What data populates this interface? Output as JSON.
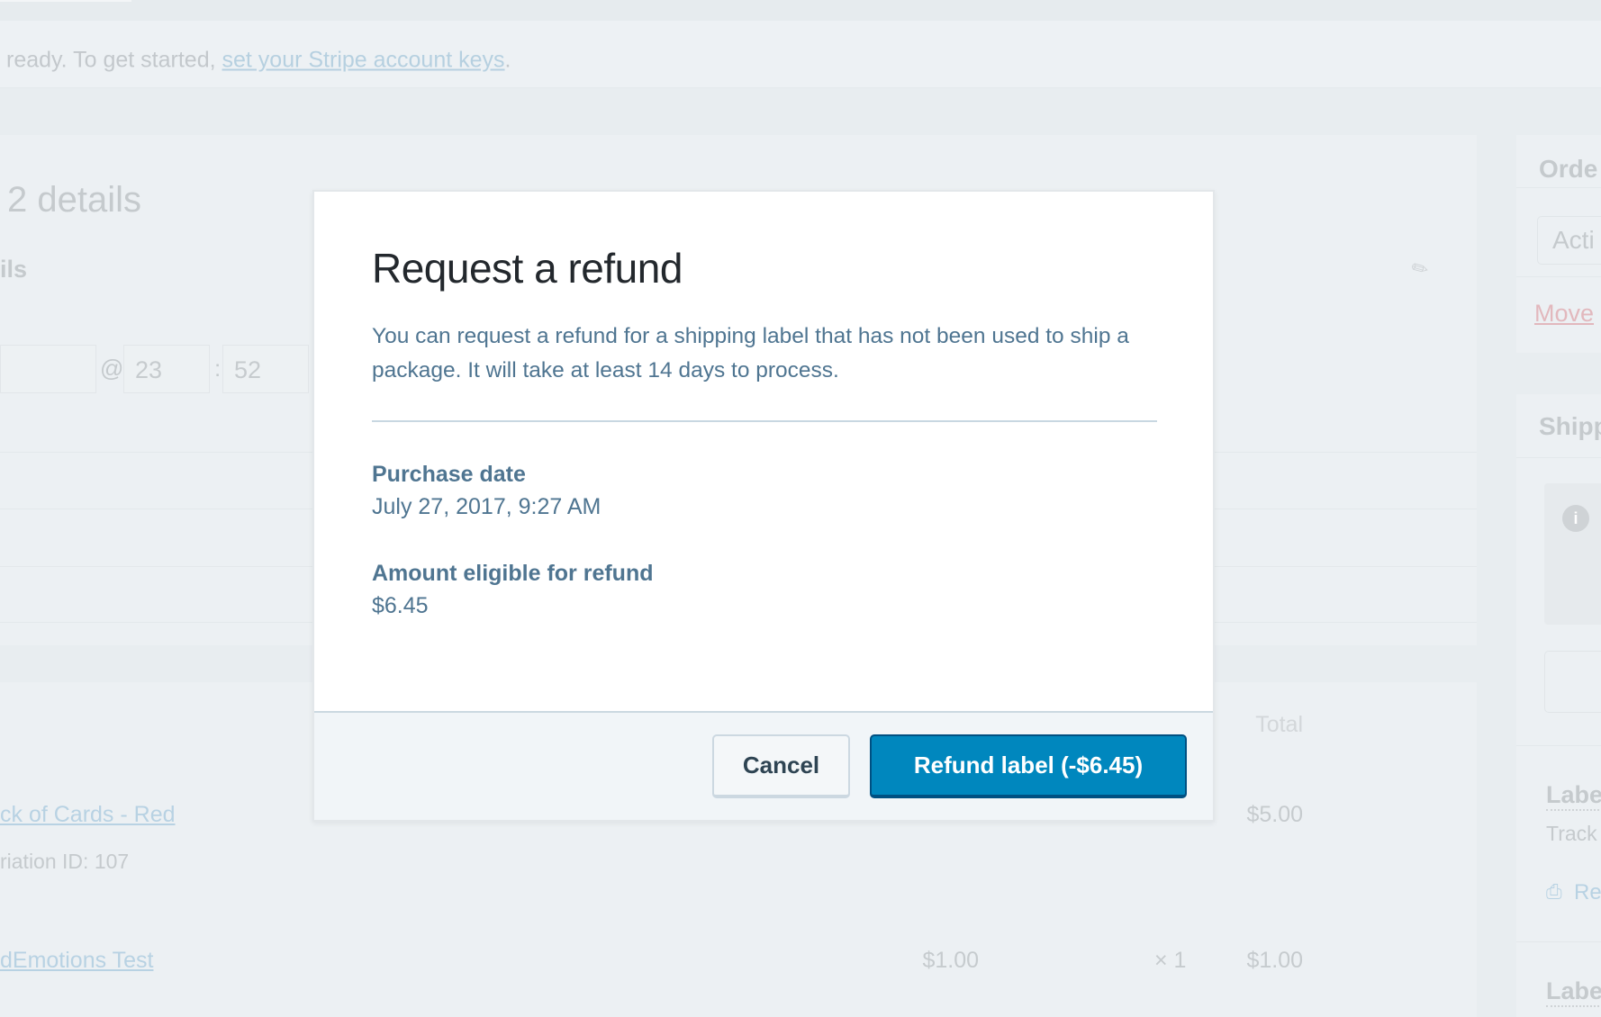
{
  "notice": {
    "text": "ready. To get started, ",
    "link": "set your Stripe account keys",
    "suffix": "."
  },
  "order": {
    "title": "2 details",
    "section": "ils",
    "at": "@",
    "hour": "23",
    "colon": ":",
    "minute": "52"
  },
  "items": {
    "total_header": "Total",
    "rows": [
      {
        "name": "ck of Cards - Red",
        "meta": "riation ID: 107",
        "total": "$5.00"
      },
      {
        "name": "dEmotions Test",
        "cost": "$1.00",
        "qty": "× 1",
        "total": "$1.00"
      }
    ]
  },
  "sidebar": {
    "order_title": "Orde",
    "actions": "Acti",
    "move": "Move",
    "shipping_title": "Shipp",
    "label1": "Labe",
    "tracking": "Track",
    "reprint": "Re",
    "label2": "Labe"
  },
  "modal": {
    "title": "Request a refund",
    "description": "You can request a refund for a shipping label that has not been used to ship a package. It will take at least 14 days to process.",
    "purchase_date_label": "Purchase date",
    "purchase_date": "July 27, 2017, 9:27 AM",
    "amount_label": "Amount eligible for refund",
    "amount": "$6.45",
    "cancel": "Cancel",
    "refund": "Refund label (-$6.45)"
  },
  "colors": {
    "primary": "#0087be",
    "text": "#4f7591"
  }
}
